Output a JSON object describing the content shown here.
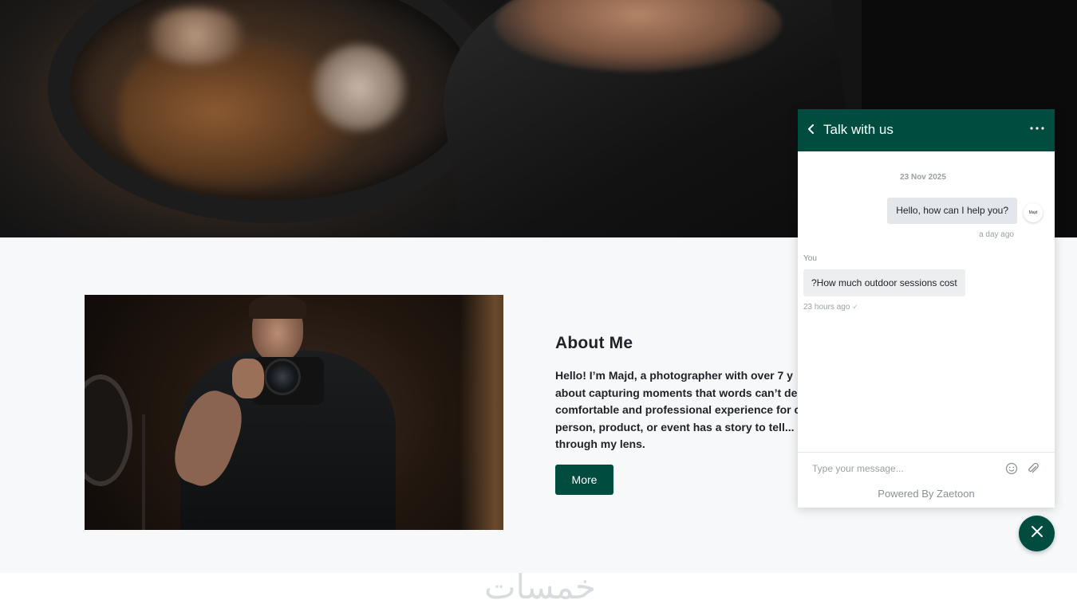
{
  "about": {
    "title": "About Me",
    "text_lines": [
      "Hello! I’m Majd, a photographer with over 7 y",
      "about capturing moments that words can’t de",
      "comfortable and professional experience for c",
      "person, product, or event has a story to tell...",
      "through my lens."
    ],
    "more_label": "More"
  },
  "watermark": {
    "text": "خمسات"
  },
  "chat": {
    "title": "Talk with us",
    "date": "23 Nov 2025",
    "agent_avatar_text": "Majd",
    "messages": [
      {
        "from": "agent",
        "text": "Hello, how can I help you?",
        "time": "a day ago"
      },
      {
        "from": "you",
        "sender_label": "You",
        "text": "?How much outdoor sessions cost",
        "time": "23 hours ago"
      }
    ],
    "input_placeholder": "Type your message...",
    "powered_by": "Powered By Zaetoon"
  },
  "icons": {
    "back": "chevron-left-icon",
    "menu": "more-horizontal-icon",
    "emoji": "smiley-icon",
    "attach": "paperclip-icon",
    "close": "close-icon",
    "read": "check-icon"
  },
  "colors": {
    "brand": "#004d40",
    "section_bg": "#f6f8fa",
    "bubble_agent": "#e3e6ea",
    "bubble_user": "#eceef0"
  }
}
